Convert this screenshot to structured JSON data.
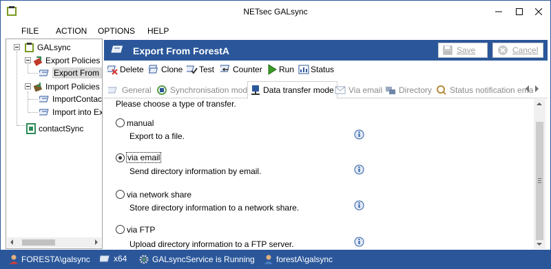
{
  "window": {
    "title": "NETsec GALsync"
  },
  "menu": [
    "FILE",
    "ACTION",
    "OPTIONS",
    "HELP"
  ],
  "tree": {
    "root": "GALsync",
    "export_policies": "Export Policies",
    "export_from": "Export From F",
    "import_policies": "Import Policies",
    "import_contact": "ImportContact",
    "import_into": "Import into Exc",
    "contact_sync": "contactSync"
  },
  "header": {
    "title": "Export From ForestA",
    "save_label": "Save",
    "cancel_label": "Cancel"
  },
  "toolbar": {
    "delete": "Delete",
    "clone": "Clone",
    "test": "Test",
    "counter": "Counter",
    "run": "Run",
    "status": "Status"
  },
  "tabs": {
    "general": "General",
    "sync_mode": "Synchronisation mode",
    "data_transfer": "Data transfer mode",
    "via_email": "Via email",
    "directory": "Directory",
    "status_notification": "Status notification ema"
  },
  "content": {
    "prompt": "Please choose a type of transfer.",
    "options": [
      {
        "label": "manual",
        "description": "Export to a file.",
        "selected": false
      },
      {
        "label": "via email",
        "description": "Send directory information by email.",
        "selected": true
      },
      {
        "label": "via network share",
        "description": "Store directory information to a network share.",
        "selected": false
      },
      {
        "label": "via FTP",
        "description": "Upload directory information to a FTP server.",
        "selected": false
      }
    ]
  },
  "statusbar": {
    "user": "FORESTA\\galsync",
    "arch": "x64",
    "service": "GALsyncService is Running",
    "account": "forestA\\galsync"
  },
  "colors": {
    "accent": "#2b579a",
    "info_icon": "#2f5fa8"
  }
}
